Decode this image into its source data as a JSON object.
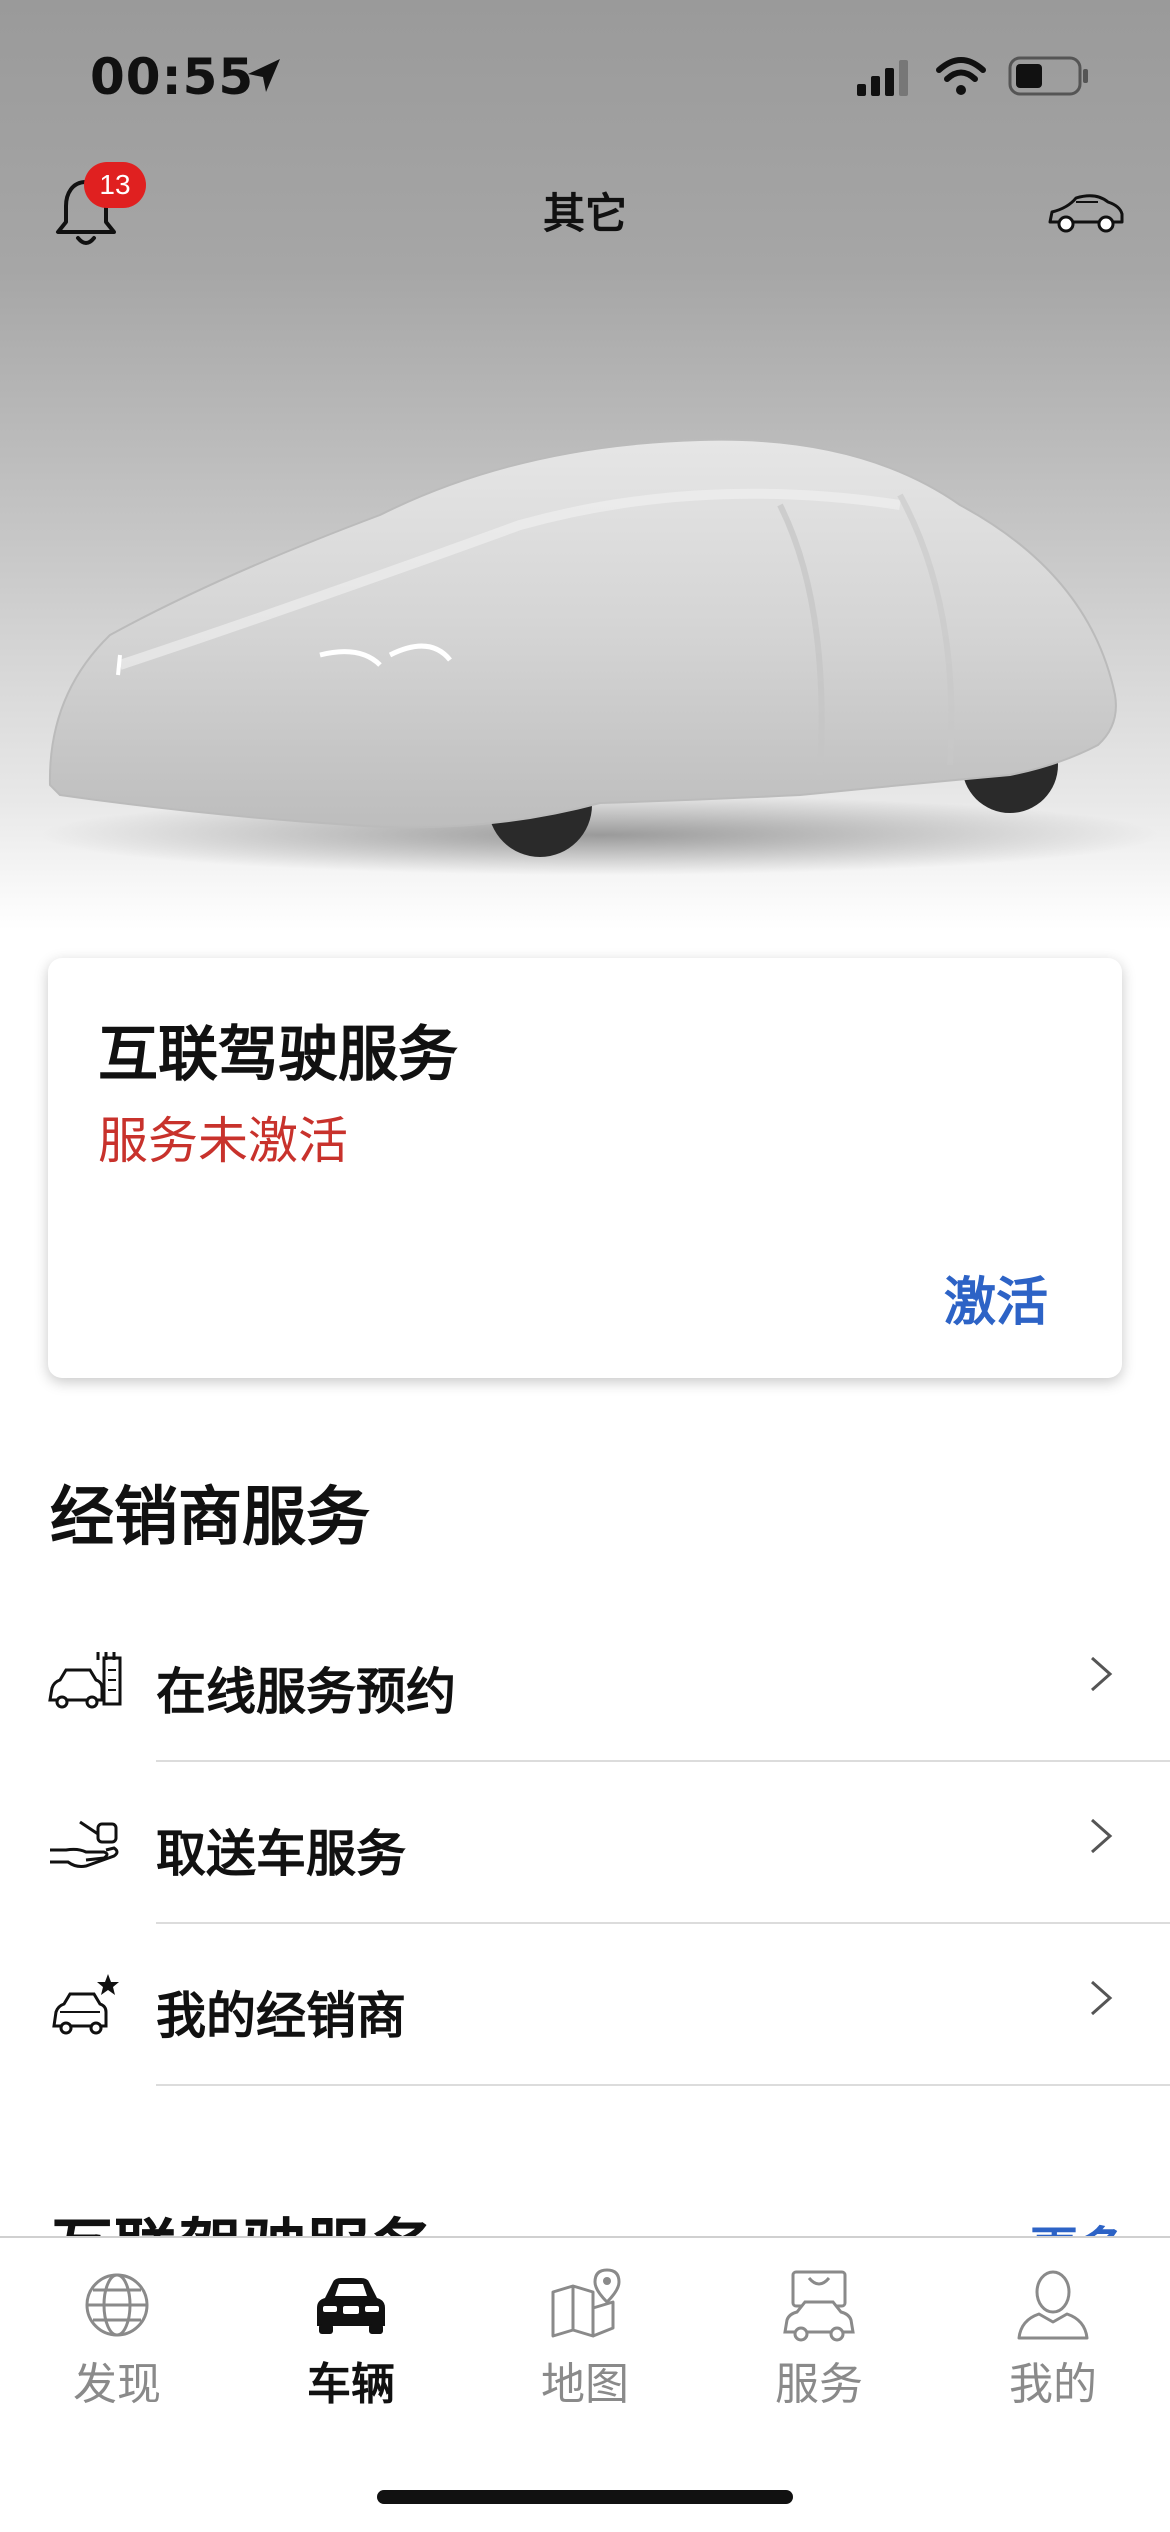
{
  "status_bar": {
    "time": "00:55",
    "icons": [
      "location-arrow-icon",
      "cellular-signal-icon",
      "wifi-icon",
      "battery-icon"
    ]
  },
  "nav": {
    "title": "其它",
    "notification_count": "13",
    "left_icon": "bell-icon",
    "right_icon": "car-switch-icon"
  },
  "connected_card": {
    "title": "互联驾驶服务",
    "status": "服务未激活",
    "action": "激活",
    "status_color": "#c8322c",
    "action_color": "#2d63c6"
  },
  "dealer_section": {
    "title": "经销商服务",
    "items": [
      {
        "label": "在线服务预约",
        "icon": "car-calendar-icon"
      },
      {
        "label": "取送车服务",
        "icon": "hand-key-icon"
      },
      {
        "label": "我的经销商",
        "icon": "car-star-icon"
      }
    ]
  },
  "next_section": {
    "title": "互联驾驶服务",
    "more": "更多"
  },
  "tabs": [
    {
      "label": "发现",
      "icon": "globe-icon",
      "active": false
    },
    {
      "label": "车辆",
      "icon": "car-front-icon",
      "active": true
    },
    {
      "label": "地图",
      "icon": "map-pin-icon",
      "active": false
    },
    {
      "label": "服务",
      "icon": "service-bag-icon",
      "active": false
    },
    {
      "label": "我的",
      "icon": "person-icon",
      "active": false
    }
  ]
}
